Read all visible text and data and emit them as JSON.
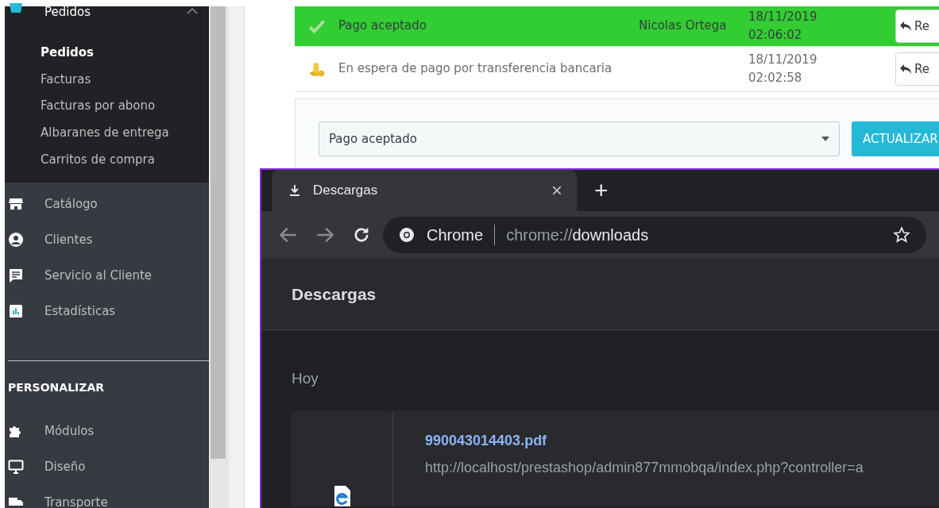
{
  "sidebar": {
    "open_section": {
      "label": "Pedidos",
      "expanded": true,
      "children": [
        {
          "label": "Pedidos",
          "selected": true
        },
        {
          "label": "Facturas",
          "selected": false
        },
        {
          "label": "Facturas por abono",
          "selected": false
        },
        {
          "label": "Albaranes de entrega",
          "selected": false
        },
        {
          "label": "Carritos de compra",
          "selected": false
        }
      ]
    },
    "items": [
      {
        "label": "Catálogo"
      },
      {
        "label": "Clientes"
      },
      {
        "label": "Servicio al Cliente"
      },
      {
        "label": "Estadísticas"
      }
    ],
    "section_title": "PERSONALIZAR",
    "section_items": [
      {
        "label": "Módulos"
      },
      {
        "label": "Diseño"
      },
      {
        "label": "Transporte"
      }
    ]
  },
  "history": {
    "rows": [
      {
        "kind": "accepted",
        "status": "Pago aceptado",
        "employee": "Nicolas Ortega",
        "date": "18/11/2019",
        "time": "02:06:02",
        "button": "Re"
      },
      {
        "kind": "waiting",
        "status": "En espera de pago por transferencia bancaria",
        "date": "18/11/2019",
        "time": "02:02:58",
        "button": "Re"
      }
    ],
    "status_select": {
      "value": "Pago aceptado"
    },
    "update_button": "ACTUALIZAR"
  },
  "browser": {
    "tab": {
      "title": "Descargas",
      "close": "×"
    },
    "new_tab": "+",
    "omnibox": {
      "chip": "Chrome",
      "url_scheme": "chrome://",
      "url_host": "downloads"
    },
    "page_title": "Descargas",
    "date_group": "Hoy",
    "downloads": [
      {
        "file": "990043014403.pdf",
        "url": "http://localhost/prestashop/admin877mmobqa/index.php?controller=a"
      }
    ]
  }
}
